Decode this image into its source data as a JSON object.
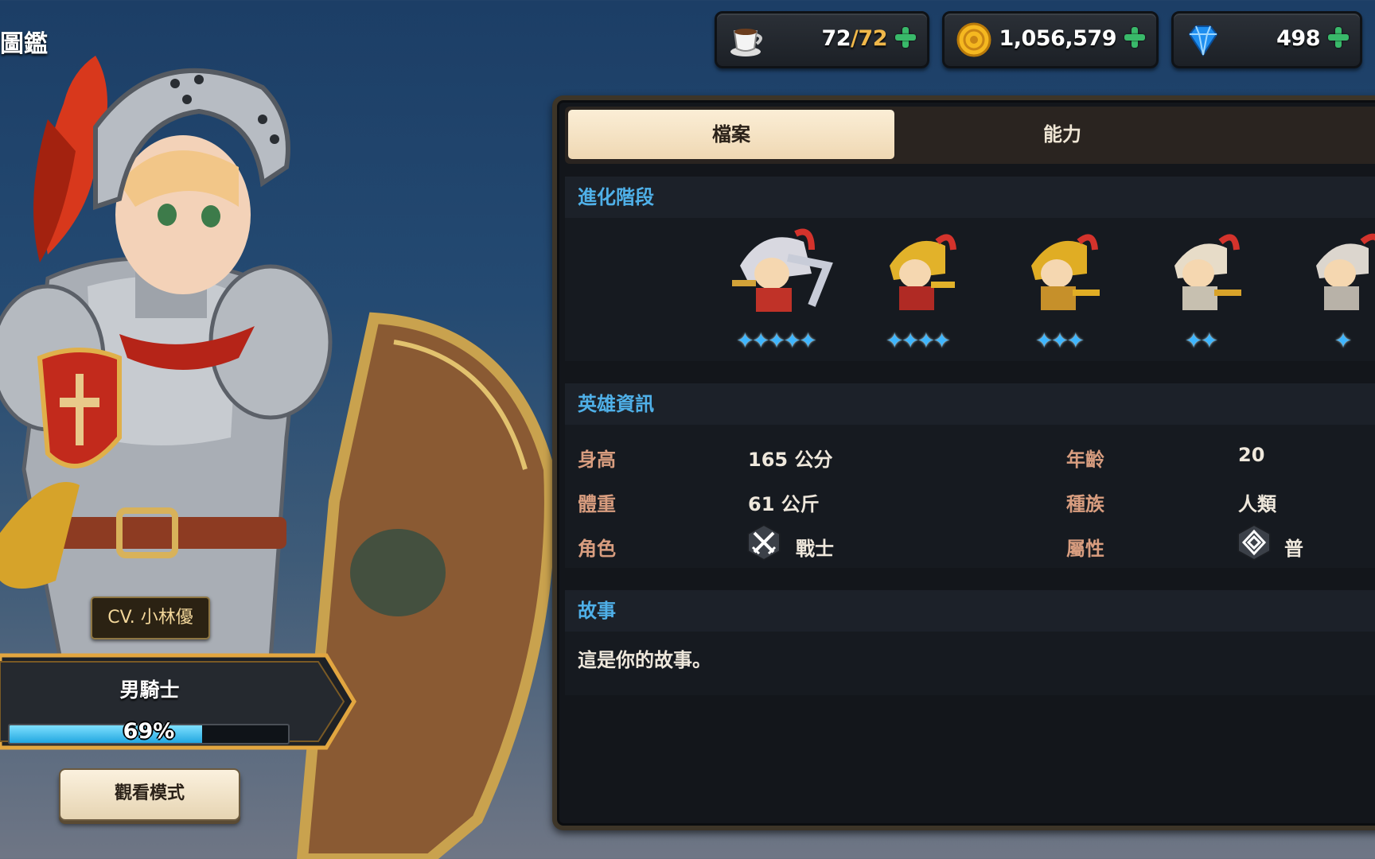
{
  "title": "圖鑑",
  "currencies": {
    "stamina": {
      "icon": "coffee-cup-icon",
      "current": "72",
      "max": "72",
      "separator": "/"
    },
    "gold": {
      "icon": "gold-coin-icon",
      "value": "1,056,579"
    },
    "gems": {
      "icon": "blue-gem-icon",
      "value": "498"
    }
  },
  "hero": {
    "cv_label": "CV. 小林優",
    "name": "男騎士",
    "progress_percent": 69,
    "progress_text": "69%",
    "view_mode_label": "觀看模式"
  },
  "tabs": [
    {
      "label": "檔案",
      "active": true
    },
    {
      "label": "能力",
      "active": false
    }
  ],
  "sections": {
    "evolution": {
      "title": "進化階段",
      "stages": [
        {
          "stars": 5,
          "star_text": "✦✦✦✦✦"
        },
        {
          "stars": 4,
          "star_text": "✦✦✦✦"
        },
        {
          "stars": 3,
          "star_text": "✦✦✦"
        },
        {
          "stars": 2,
          "star_text": "✦✦"
        },
        {
          "stars": 1,
          "star_text": "✦"
        }
      ]
    },
    "info": {
      "title": "英雄資訊",
      "height_label": "身高",
      "height_value": "165  公分",
      "weight_label": "體重",
      "weight_value": "61  公斤",
      "role_label": "角色",
      "role_value": "戰士",
      "role_icon": "crossed-swords-icon",
      "age_label": "年齡",
      "age_value": "20",
      "race_label": "種族",
      "race_value": "人類",
      "attribute_label": "屬性",
      "attribute_value": "普",
      "attribute_icon": "neutral-element-icon"
    },
    "story": {
      "title": "故事",
      "text": "這是你的故事。"
    }
  },
  "colors": {
    "section_title": "#4fb0e8",
    "info_label": "#d89d7f",
    "star": "#3fb6ff",
    "plus": "#39b96a",
    "progress_fill": "#22a7e0"
  }
}
